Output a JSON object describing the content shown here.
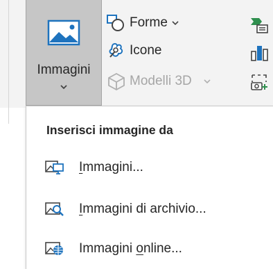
{
  "ribbon": {
    "big_button": {
      "label": "Immagini",
      "icon": "picture-icon",
      "state": "pressed"
    },
    "commands": [
      {
        "label": "Forme",
        "icon": "shapes-icon",
        "has_dropdown": true,
        "enabled": true
      },
      {
        "label": "Icone",
        "icon": "icons-icon",
        "has_dropdown": false,
        "enabled": true
      },
      {
        "label": "Modelli 3D",
        "icon": "3d-models-icon",
        "has_dropdown": true,
        "enabled": false
      }
    ],
    "right_icons": [
      "smartart-icon",
      "chart-icon",
      "screenshot-icon"
    ]
  },
  "menu": {
    "header": "Inserisci immagine da",
    "items": [
      {
        "label": "Immagini...",
        "accel": "I",
        "rest": "mmagini...",
        "icon": "picture-from-device-icon"
      },
      {
        "label": "Immagini di archivio...",
        "accel": "I",
        "rest": "mmagini di archivio...",
        "icon": "stock-images-icon"
      },
      {
        "label": "Immagini online...",
        "pre": "Immagini ",
        "accel": "o",
        "rest": "nline...",
        "icon": "online-pictures-icon"
      }
    ]
  },
  "colors": {
    "pressed_bg": "#c6c6c6",
    "ribbon_bg": "#f3f3f3",
    "accent_blue": "#1e73be",
    "accent_green": "#2f8f4e",
    "disabled_text": "#a6a6a6"
  }
}
